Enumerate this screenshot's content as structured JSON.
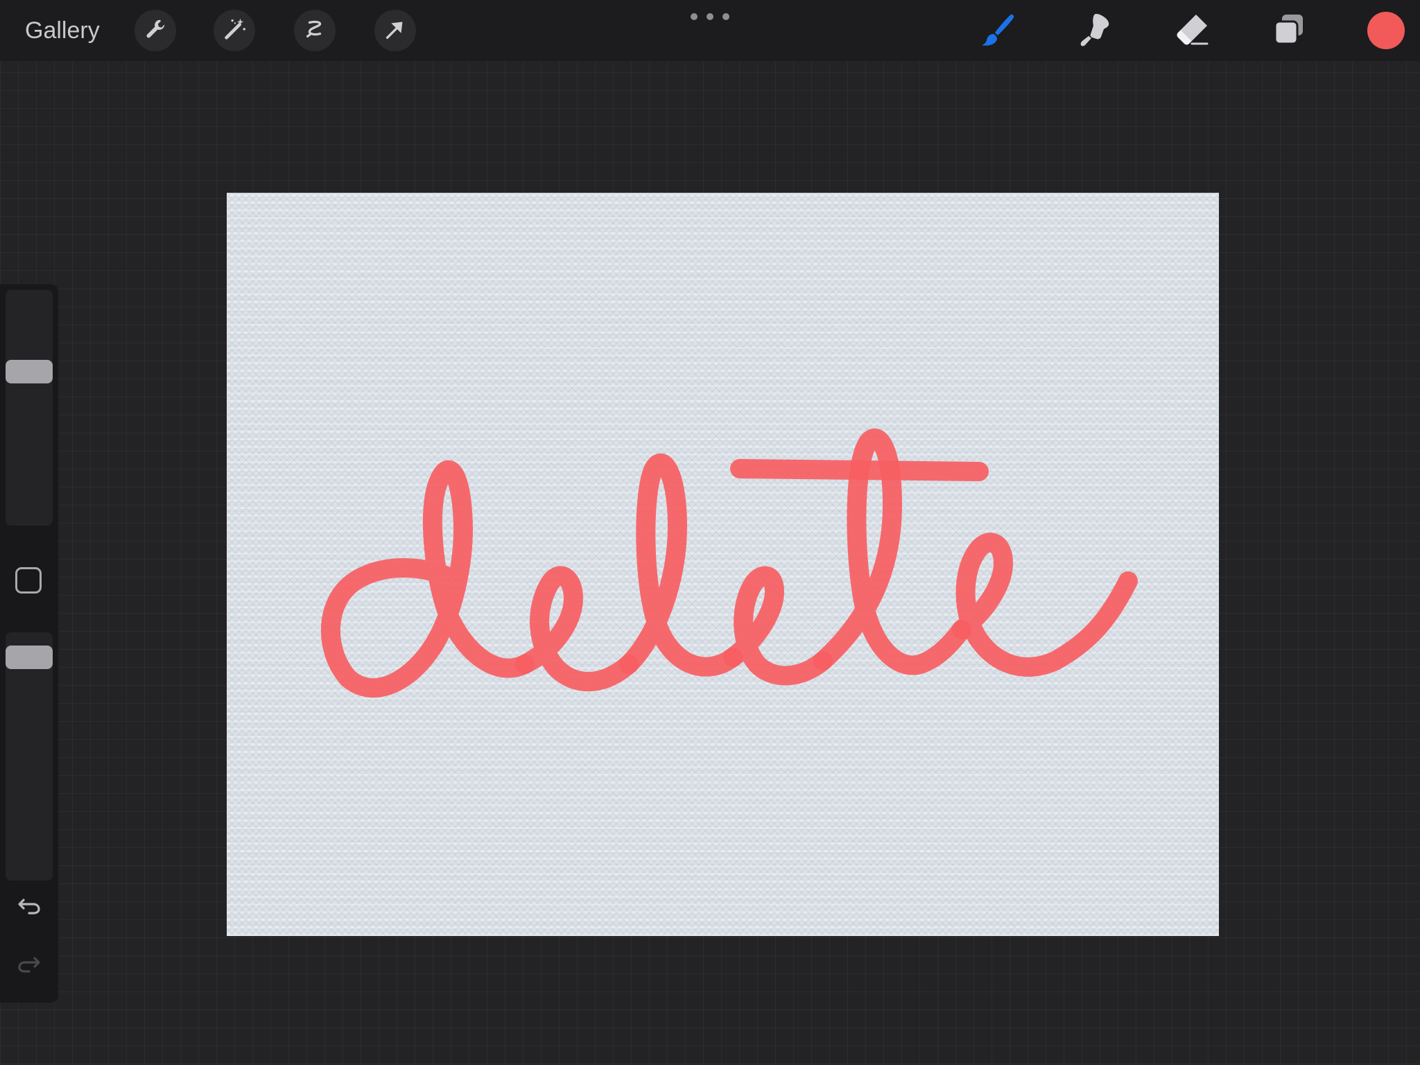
{
  "topbar": {
    "gallery_label": "Gallery",
    "left_tools": [
      "wrench-icon",
      "magic-wand-icon",
      "selection-icon",
      "transform-arrow-icon"
    ],
    "right_tools": [
      "brush-icon",
      "smudge-icon",
      "eraser-icon",
      "layers-icon"
    ],
    "active_tool": "brush-icon",
    "active_color": "#f25a5a",
    "accent_color": "#1a73e8"
  },
  "sidebar": {
    "brush_size_level": 0.67,
    "opacity_level": 0.94,
    "modify_button": "square-icon",
    "undo": "undo-icon",
    "redo": "redo-icon"
  },
  "canvas": {
    "paper_color": "#dde2e8",
    "lettering_color": "#f65e62",
    "lettering_text": "delete"
  }
}
